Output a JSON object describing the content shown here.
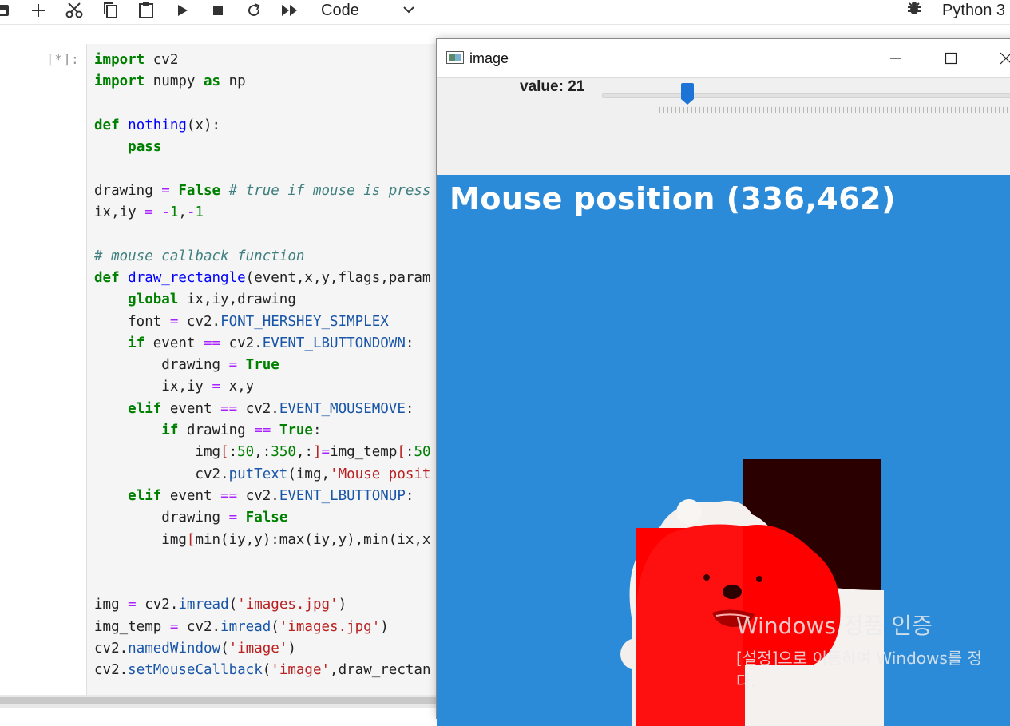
{
  "toolbar": {
    "cell_type": "Code",
    "kernel_name": "Python 3"
  },
  "cell": {
    "prompt": "[*]:"
  },
  "code_lines": [
    [
      {
        "t": "import",
        "c": "kw"
      },
      {
        "t": " cv2",
        "c": ""
      }
    ],
    [
      {
        "t": "import",
        "c": "kw"
      },
      {
        "t": " numpy ",
        "c": ""
      },
      {
        "t": "as",
        "c": "kw"
      },
      {
        "t": " np",
        "c": ""
      }
    ],
    [],
    [
      {
        "t": "def",
        "c": "kw"
      },
      {
        "t": " ",
        "c": ""
      },
      {
        "t": "nothing",
        "c": "fn"
      },
      {
        "t": "(x):",
        "c": ""
      }
    ],
    [
      {
        "t": "    ",
        "c": ""
      },
      {
        "t": "pass",
        "c": "kw"
      }
    ],
    [],
    [
      {
        "t": "drawing ",
        "c": ""
      },
      {
        "t": "=",
        "c": "op"
      },
      {
        "t": " ",
        "c": ""
      },
      {
        "t": "False",
        "c": "kw"
      },
      {
        "t": " ",
        "c": ""
      },
      {
        "t": "# true if mouse is press",
        "c": "cm"
      }
    ],
    [
      {
        "t": "ix,iy ",
        "c": ""
      },
      {
        "t": "=",
        "c": "op"
      },
      {
        "t": " ",
        "c": ""
      },
      {
        "t": "-",
        "c": "op"
      },
      {
        "t": "1",
        "c": "num"
      },
      {
        "t": ",",
        "c": ""
      },
      {
        "t": "-",
        "c": "op"
      },
      {
        "t": "1",
        "c": "num"
      }
    ],
    [],
    [
      {
        "t": "# mouse callback function",
        "c": "cm"
      }
    ],
    [
      {
        "t": "def",
        "c": "kw"
      },
      {
        "t": " ",
        "c": ""
      },
      {
        "t": "draw_rectangle",
        "c": "fn"
      },
      {
        "t": "(event,x,y,flags,param",
        "c": ""
      }
    ],
    [
      {
        "t": "    ",
        "c": ""
      },
      {
        "t": "global",
        "c": "kw"
      },
      {
        "t": " ix,iy,drawing",
        "c": ""
      }
    ],
    [
      {
        "t": "    font ",
        "c": ""
      },
      {
        "t": "=",
        "c": "op"
      },
      {
        "t": " cv2.",
        "c": ""
      },
      {
        "t": "FONT_HERSHEY_SIMPLEX",
        "c": "at"
      }
    ],
    [
      {
        "t": "    ",
        "c": ""
      },
      {
        "t": "if",
        "c": "kw"
      },
      {
        "t": " event ",
        "c": ""
      },
      {
        "t": "==",
        "c": "op"
      },
      {
        "t": " cv2.",
        "c": ""
      },
      {
        "t": "EVENT_LBUTTONDOWN",
        "c": "at"
      },
      {
        "t": ":",
        "c": ""
      }
    ],
    [
      {
        "t": "        drawing ",
        "c": ""
      },
      {
        "t": "=",
        "c": "op"
      },
      {
        "t": " ",
        "c": ""
      },
      {
        "t": "True",
        "c": "kw"
      }
    ],
    [
      {
        "t": "        ix,iy ",
        "c": ""
      },
      {
        "t": "=",
        "c": "op"
      },
      {
        "t": " x,y",
        "c": ""
      }
    ],
    [
      {
        "t": "    ",
        "c": ""
      },
      {
        "t": "elif",
        "c": "kw"
      },
      {
        "t": " event ",
        "c": ""
      },
      {
        "t": "==",
        "c": "op"
      },
      {
        "t": " cv2.",
        "c": ""
      },
      {
        "t": "EVENT_MOUSEMOVE",
        "c": "at"
      },
      {
        "t": ":",
        "c": ""
      }
    ],
    [
      {
        "t": "        ",
        "c": ""
      },
      {
        "t": "if",
        "c": "kw"
      },
      {
        "t": " drawing ",
        "c": ""
      },
      {
        "t": "==",
        "c": "op"
      },
      {
        "t": " ",
        "c": ""
      },
      {
        "t": "True",
        "c": "kw"
      },
      {
        "t": ":",
        "c": ""
      }
    ],
    [
      {
        "t": "            img",
        "c": ""
      },
      {
        "t": "[",
        "c": "hl"
      },
      {
        "t": ":",
        "c": ""
      },
      {
        "t": "50",
        "c": "num"
      },
      {
        "t": ",:",
        "c": ""
      },
      {
        "t": "350",
        "c": "num"
      },
      {
        "t": ",:",
        "c": ""
      },
      {
        "t": "]",
        "c": "hl"
      },
      {
        "t": "=",
        "c": "op"
      },
      {
        "t": "img_temp",
        "c": ""
      },
      {
        "t": "[",
        "c": "hl"
      },
      {
        "t": ":",
        "c": ""
      },
      {
        "t": "50",
        "c": "num"
      }
    ],
    [
      {
        "t": "            cv2.",
        "c": ""
      },
      {
        "t": "putText",
        "c": "at"
      },
      {
        "t": "(img,",
        "c": ""
      },
      {
        "t": "'Mouse posit",
        "c": "str"
      }
    ],
    [
      {
        "t": "    ",
        "c": ""
      },
      {
        "t": "elif",
        "c": "kw"
      },
      {
        "t": " event ",
        "c": ""
      },
      {
        "t": "==",
        "c": "op"
      },
      {
        "t": " cv2.",
        "c": ""
      },
      {
        "t": "EVENT_LBUTTONUP",
        "c": "at"
      },
      {
        "t": ":",
        "c": ""
      }
    ],
    [
      {
        "t": "        drawing ",
        "c": ""
      },
      {
        "t": "=",
        "c": "op"
      },
      {
        "t": " ",
        "c": ""
      },
      {
        "t": "False",
        "c": "kw"
      }
    ],
    [
      {
        "t": "        img",
        "c": ""
      },
      {
        "t": "[",
        "c": "hl"
      },
      {
        "t": "min(iy,y):max(iy,y),min(ix,x",
        "c": ""
      }
    ],
    [],
    [],
    [
      {
        "t": "img ",
        "c": ""
      },
      {
        "t": "=",
        "c": "op"
      },
      {
        "t": " cv2.",
        "c": ""
      },
      {
        "t": "imread",
        "c": "at"
      },
      {
        "t": "(",
        "c": ""
      },
      {
        "t": "'images.jpg'",
        "c": "str"
      },
      {
        "t": ")",
        "c": ""
      }
    ],
    [
      {
        "t": "img_temp ",
        "c": ""
      },
      {
        "t": "=",
        "c": "op"
      },
      {
        "t": " cv2.",
        "c": ""
      },
      {
        "t": "imread",
        "c": "at"
      },
      {
        "t": "(",
        "c": ""
      },
      {
        "t": "'images.jpg'",
        "c": "str"
      },
      {
        "t": ")",
        "c": ""
      }
    ],
    [
      {
        "t": "cv2.",
        "c": ""
      },
      {
        "t": "namedWindow",
        "c": "at"
      },
      {
        "t": "(",
        "c": ""
      },
      {
        "t": "'image'",
        "c": "str"
      },
      {
        "t": ")",
        "c": ""
      }
    ],
    [
      {
        "t": "cv2.",
        "c": ""
      },
      {
        "t": "setMouseCallback",
        "c": "at"
      },
      {
        "t": "(",
        "c": ""
      },
      {
        "t": "'image'",
        "c": "str"
      },
      {
        "t": ",draw_rectan",
        "c": ""
      }
    ]
  ],
  "cv_window": {
    "title": "image",
    "trackbar_label": "value: 21",
    "trackbar_value": 21,
    "overlay_text": "Mouse position (336,462)"
  },
  "watermark": {
    "line1": "Windows 정품 인증",
    "line2": "[설정]으로 이동하여 Windows를 정",
    "line3": "다."
  },
  "colors": {
    "canvas_blue": "#2b8bd9",
    "red": "#ff0000",
    "dark_red": "#2a0000",
    "trackbar_thumb": "#1e73d6"
  },
  "icons": [
    "save-icon",
    "add-cell-icon",
    "cut-icon",
    "copy-icon",
    "paste-icon",
    "run-icon",
    "stop-icon",
    "restart-icon",
    "fast-forward-icon",
    "chevron-down-icon",
    "bug-icon",
    "window-app-icon",
    "minimize-icon",
    "maximize-icon",
    "close-icon"
  ]
}
